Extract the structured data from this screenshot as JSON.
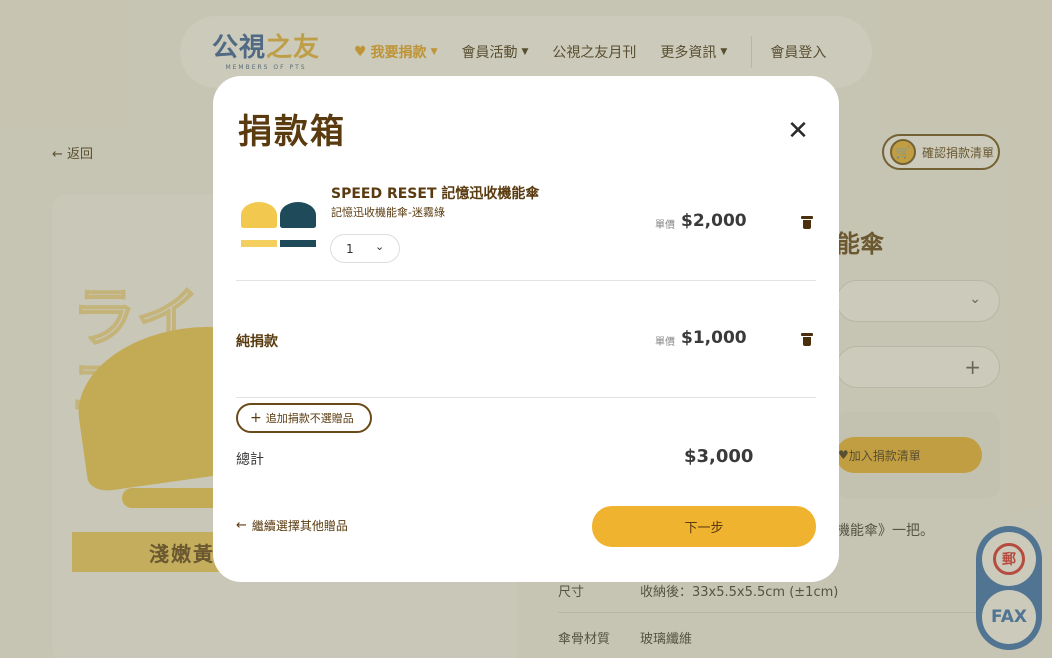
{
  "nav": {
    "logo_text_left": "公視",
    "logo_text_right": "之友",
    "logo_subtitle": "MEMBERS OF PTS",
    "items": [
      {
        "label": "我要捐款",
        "has_caret": true,
        "primary": true
      },
      {
        "label": "會員活動",
        "has_caret": true
      },
      {
        "label": "公視之友月刊",
        "has_caret": false
      },
      {
        "label": "更多資訊",
        "has_caret": true
      }
    ],
    "login_label": "會員登入"
  },
  "background": {
    "back_label": "返回",
    "confirm_label": "確認捐款清單",
    "color_label": "淺嫩黃",
    "title_fragment": "能傘",
    "add_to_list_label": "加入捐款清單",
    "desc_fragment": "機能傘》一把。",
    "specs": [
      {
        "key": "尺寸",
        "value": "收納後：33x5.5x5.5cm (±1cm)"
      },
      {
        "key": "傘骨材質",
        "value": "玻璃纖維"
      }
    ],
    "fax_label": "FAX",
    "post_label": "郵"
  },
  "modal": {
    "title": "捐款箱",
    "close_icon": "close-icon",
    "items": [
      {
        "name": "SPEED RESET 記憶迅收機能傘",
        "variant": "記憶迅收機能傘-迷霧綠",
        "quantity": "1",
        "unit_label": "單價",
        "price": "$2,000"
      },
      {
        "name": "純捐款",
        "unit_label": "單價",
        "price": "$1,000"
      }
    ],
    "add_donation_label": "追加捐款不選贈品",
    "total_label": "總計",
    "total_value": "$3,000",
    "continue_label": "繼續選擇其他贈品",
    "next_label": "下一步"
  },
  "colors": {
    "brand_brown": "#5a3b10",
    "accent_yellow": "#f0b32f",
    "brand_blue": "#2c6bb8"
  }
}
